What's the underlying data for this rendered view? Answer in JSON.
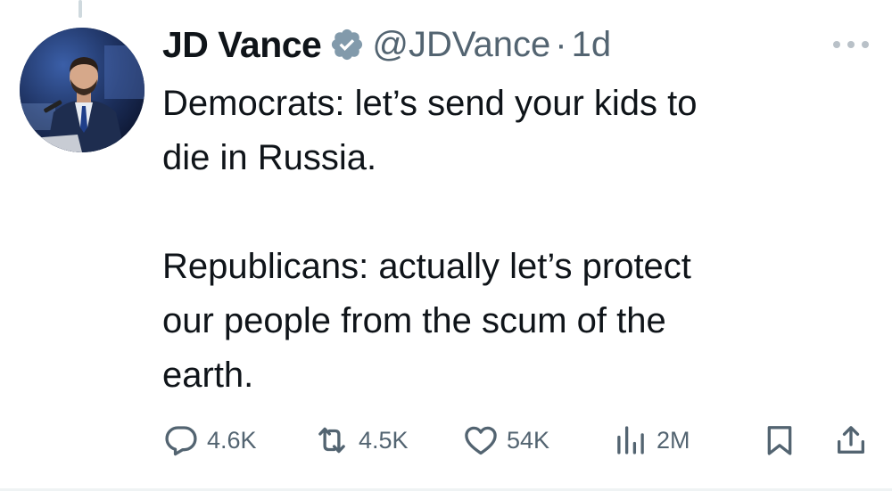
{
  "author": {
    "name": "JD Vance",
    "handle": "@JDVance",
    "separator": "·",
    "timestamp": "1d",
    "verified": true,
    "verified_color": "#829aab"
  },
  "tweet": {
    "paragraph_1_line_1": "Democrats: let’s send your kids to",
    "paragraph_1_line_2": "die in Russia.",
    "paragraph_2_line_1": "Republicans: actually let’s protect",
    "paragraph_2_line_2": "our people from the scum of the",
    "paragraph_2_line_3": "earth."
  },
  "actions": {
    "replies": "4.6K",
    "retweets": "4.5K",
    "likes": "54K",
    "views": "2M"
  },
  "icons": {
    "reply": "reply-icon",
    "retweet": "retweet-icon",
    "like": "heart-icon",
    "views": "views-icon",
    "bookmark": "bookmark-icon",
    "share": "share-icon",
    "more": "more-icon",
    "verified": "verified-badge-icon"
  },
  "colors": {
    "text_primary": "#0f1419",
    "text_secondary": "#536471",
    "icon_color": "#536471"
  }
}
